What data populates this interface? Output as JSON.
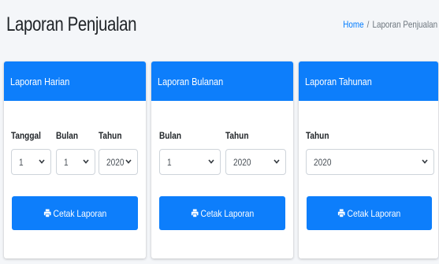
{
  "page": {
    "title": "Laporan Penjualan"
  },
  "breadcrumb": {
    "home": "Home",
    "separator": "/",
    "current": "Laporan Penjualan"
  },
  "colors": {
    "primary": "#0d7efb",
    "background": "#f4f6f9"
  },
  "cards": {
    "harian": {
      "title": "Laporan Harian",
      "labels": {
        "tanggal": "Tanggal",
        "bulan": "Bulan",
        "tahun": "Tahun"
      },
      "values": {
        "tanggal": "1",
        "bulan": "1",
        "tahun": "2020"
      },
      "button": "Cetak Laporan",
      "button_icon": "print-icon"
    },
    "bulanan": {
      "title": "Laporan Bulanan",
      "labels": {
        "bulan": "Bulan",
        "tahun": "Tahun"
      },
      "values": {
        "bulan": "1",
        "tahun": "2020"
      },
      "button": "Cetak Laporan",
      "button_icon": "print-icon"
    },
    "tahunan": {
      "title": "Laporan Tahunan",
      "labels": {
        "tahun": "Tahun"
      },
      "values": {
        "tahun": "2020"
      },
      "button": "Cetak Laporan",
      "button_icon": "print-icon"
    }
  }
}
